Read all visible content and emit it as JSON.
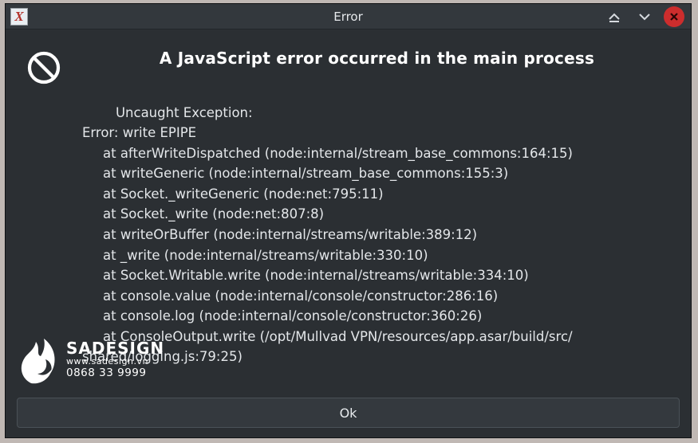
{
  "titlebar": {
    "app_glyph": "X",
    "title": "Error"
  },
  "dialog": {
    "heading": "A JavaScript error occurred in the main process",
    "exception_label": "Uncaught Exception:",
    "error_line": "Error: write EPIPE",
    "stack": [
      "at afterWriteDispatched (node:internal/stream_base_commons:164:15)",
      "at writeGeneric (node:internal/stream_base_commons:155:3)",
      "at Socket._writeGeneric (node:net:795:11)",
      "at Socket._write (node:net:807:8)",
      "at writeOrBuffer (node:internal/streams/writable:389:12)",
      "at _write (node:internal/streams/writable:330:10)",
      "at Socket.Writable.write (node:internal/streams/writable:334:10)",
      "at console.value (node:internal/console/constructor:286:16)",
      "at console.log (node:internal/console/constructor:360:26)",
      "at ConsoleOutput.write (/opt/Mullvad VPN/resources/app.asar/build/src/"
    ],
    "stack_tail": "shared/logging.js:79:25)"
  },
  "buttons": {
    "ok": "Ok"
  },
  "watermark": {
    "brand": "SADESIGN",
    "site": "www.sadesign.vn",
    "phone": "0868 33 9999"
  },
  "icons": {
    "minimize": "minimize-icon",
    "expand": "expand-down-icon",
    "close": "close-icon",
    "warning": "nosign-icon",
    "flame": "flame-logo-icon"
  }
}
